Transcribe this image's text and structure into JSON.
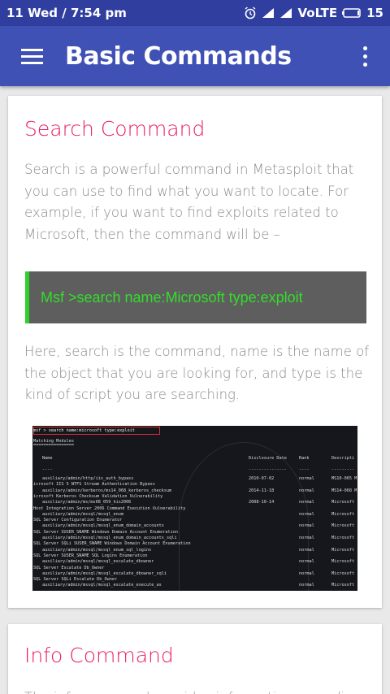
{
  "statusbar": {
    "time": "11 Wed  /  7:54 pm",
    "network": "VoLTE",
    "battery": "15"
  },
  "appbar": {
    "title": "Basic Commands"
  },
  "sections": [
    {
      "heading": "Search Command",
      "paragraph1": "Search is a powerful command in Metasploit that you can use to find what you want to locate. For example, if you want to find exploits related to Microsoft, then the command will be –",
      "code": "Msf >search name:Microsoft type:exploit",
      "paragraph2": "Here, search is the command, name is the name of the object that you are looking for, and type is the kind of script you are searching."
    },
    {
      "heading": "Info Command",
      "paragraph1": "The info command provides information regarding"
    }
  ],
  "terminal": {
    "command": "msf > search name:microsoft type:exploit",
    "title": "Matching Modules",
    "underline": "================",
    "headers": [
      "Name",
      "Disclosure Date",
      "Rank",
      "Descripti"
    ],
    "header_dashes": [
      "----",
      "---------------",
      "----",
      "---------"
    ],
    "rows": [
      {
        "name": "auxiliary/admin/http/iis_auth_bypass",
        "date": "2010-07-02",
        "rank": "normal",
        "desc": "MS10-065 M"
      },
      {
        "name": "icrosoft IIS 5 NTFS Stream Authentication Bypass",
        "date": "",
        "rank": "",
        "desc": ""
      },
      {
        "name": "auxiliary/admin/kerberos/ms14_068_kerberos_checksum",
        "date": "2014-11-18",
        "rank": "normal",
        "desc": "MS14-068 M"
      },
      {
        "name": "icrosoft Kerberos Checksum Validation Vulnerability",
        "date": "",
        "rank": "",
        "desc": ""
      },
      {
        "name": "auxiliary/admin/ms/ms08_059_his2006",
        "date": "2008-10-14",
        "rank": "normal",
        "desc": "Microsoft"
      },
      {
        "name": "Host Integration Server 2006 Command Execution Vulnerability",
        "date": "",
        "rank": "",
        "desc": ""
      },
      {
        "name": "auxiliary/admin/mssql/mssql_enum",
        "date": "",
        "rank": "normal",
        "desc": "Microsoft"
      },
      {
        "name": "SQL Server Configuration Enumerator",
        "date": "",
        "rank": "",
        "desc": ""
      },
      {
        "name": "auxiliary/admin/mssql/mssql_enum_domain_accounts",
        "date": "",
        "rank": "normal",
        "desc": "Microsoft"
      },
      {
        "name": "SQL Server SUSER_SNAME Windows Domain Account Enumeration",
        "date": "",
        "rank": "",
        "desc": ""
      },
      {
        "name": "auxiliary/admin/mssql/mssql_enum_domain_accounts_sqli",
        "date": "",
        "rank": "normal",
        "desc": "Microsoft"
      },
      {
        "name": "SQL Server SQLi SUSER_SNAME Windows Domain Account Enumeration",
        "date": "",
        "rank": "",
        "desc": ""
      },
      {
        "name": "auxiliary/admin/mssql/mssql_enum_sql_logins",
        "date": "",
        "rank": "normal",
        "desc": "Microsoft"
      },
      {
        "name": "SQL Server SUSER_SNAME SQL Logins Enumeration",
        "date": "",
        "rank": "",
        "desc": ""
      },
      {
        "name": "auxiliary/admin/mssql/mssql_escalate_dbowner",
        "date": "",
        "rank": "normal",
        "desc": "Microsoft"
      },
      {
        "name": "SQL Server Escalate Db_Owner",
        "date": "",
        "rank": "",
        "desc": ""
      },
      {
        "name": "auxiliary/admin/mssql/mssql_escalate_dbowner_sqli",
        "date": "",
        "rank": "normal",
        "desc": "Microsoft"
      },
      {
        "name": "SQL Server SQLi Escalate Db_Owner",
        "date": "",
        "rank": "",
        "desc": ""
      },
      {
        "name": "auxiliary/admin/mssql/mssql_escalate_execute_as",
        "date": "",
        "rank": "normal",
        "desc": "Microsoft"
      }
    ]
  },
  "colors": {
    "statusbar": "#303f9f",
    "appbar": "#3f51b5",
    "heading": "#e91e63",
    "code_text": "#33dd2b",
    "code_bg": "#5e5e5e"
  }
}
